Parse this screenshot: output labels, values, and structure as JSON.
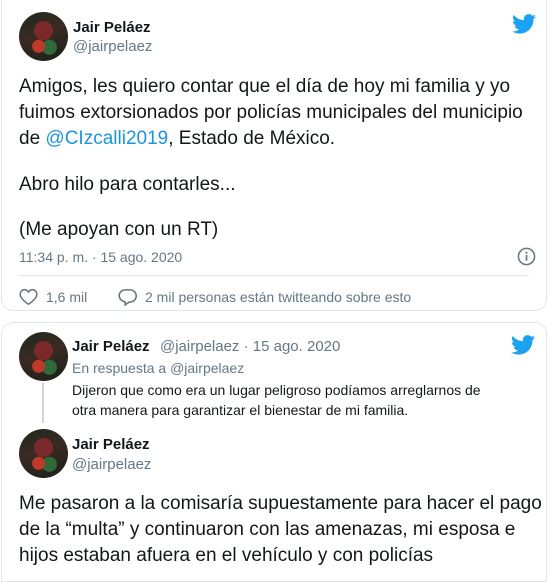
{
  "tweet1": {
    "author_name": "Jair Peláez",
    "author_handle": "@jairpelaez",
    "text_line1": "Amigos, les quiero contar que el día de hoy mi familia y yo",
    "text_line2": "fuimos extorsionados por policías municipales del municipio",
    "text_line3_pre": "de ",
    "mention": "@CIzcalli2019",
    "text_line3_post": ", Estado de México.",
    "text_line4": "Abro hilo para contarles...",
    "text_line5": "(Me apoyan con un RT)",
    "timestamp": "11:34 p. m. · 15 ago. 2020",
    "likes": "1,6 mil",
    "conversation": "2 mil personas están twitteando sobre esto"
  },
  "tweet2": {
    "author_name": "Jair Peláez",
    "author_handle_date": "@jairpelaez · 15 ago. 2020",
    "reply_to_prefix": "En respuesta a ",
    "reply_to_handle": "@jairpelaez",
    "text_line1": "Dijeron que como era un lugar peligroso podíamos arreglarnos de",
    "text_line2": "otra manera para garantizar el bienestar de mi familia."
  },
  "tweet3": {
    "author_name": "Jair Peláez",
    "author_handle": "@jairpelaez",
    "text_line1": "Me pasaron a la comisaría supuestamente para hacer el pago",
    "text_line2": "de la “multa” y continuaron con las amenazas, mi esposa e",
    "text_line3": "hijos estaban afuera en el vehículo y con policías"
  },
  "colors": {
    "twitter_blue": "#1da1f2",
    "link_blue": "#1b95e0",
    "secondary_text": "#657786",
    "border": "#e1e8ed"
  },
  "icons": [
    "twitter-bird-icon",
    "info-icon",
    "heart-icon",
    "comment-icon"
  ]
}
